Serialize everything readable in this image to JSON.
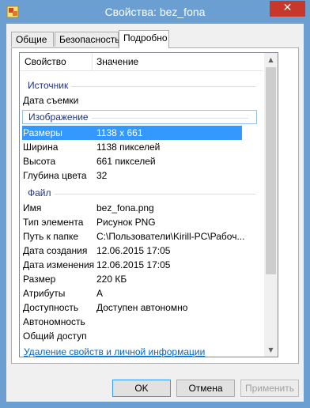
{
  "window": {
    "title": "Свойства: bez_fona",
    "close_glyph": "✕",
    "frame_color": "#6b9fd1"
  },
  "tabs": [
    {
      "label": "Общие"
    },
    {
      "label": "Безопасность"
    },
    {
      "label": "Подробно"
    }
  ],
  "columns": {
    "property": "Свойство",
    "value": "Значение"
  },
  "groups": {
    "source": "Источник",
    "image": "Изображение",
    "file": "Файл"
  },
  "rows": {
    "date_taken": {
      "k": "Дата съемки",
      "v": ""
    },
    "dimensions": {
      "k": "Размеры",
      "v": "1138 x 661"
    },
    "width": {
      "k": "Ширина",
      "v": "1138 пикселей"
    },
    "height": {
      "k": "Высота",
      "v": "661 пикселей"
    },
    "bit_depth": {
      "k": "Глубина цвета",
      "v": "32"
    },
    "name": {
      "k": "Имя",
      "v": "bez_fona.png"
    },
    "item_type": {
      "k": "Тип элемента",
      "v": "Рисунок PNG"
    },
    "folder_path": {
      "k": "Путь к папке",
      "v": "C:\\Пользователи\\Kirill-PC\\Рабоч..."
    },
    "date_created": {
      "k": "Дата создания",
      "v": "12.06.2015 17:05"
    },
    "date_modified": {
      "k": "Дата изменения",
      "v": "12.06.2015 17:05"
    },
    "size": {
      "k": "Размер",
      "v": "220 КБ"
    },
    "attributes": {
      "k": "Атрибуты",
      "v": "A"
    },
    "availability": {
      "k": "Доступность",
      "v": "Доступен автономно"
    },
    "offline_status": {
      "k": "Автономность",
      "v": ""
    },
    "shared_with": {
      "k": "Общий доступ",
      "v": ""
    }
  },
  "remove_link": "Удаление свойств и личной информации",
  "buttons": {
    "ok": "OK",
    "cancel": "Отмена",
    "apply": "Применить"
  }
}
